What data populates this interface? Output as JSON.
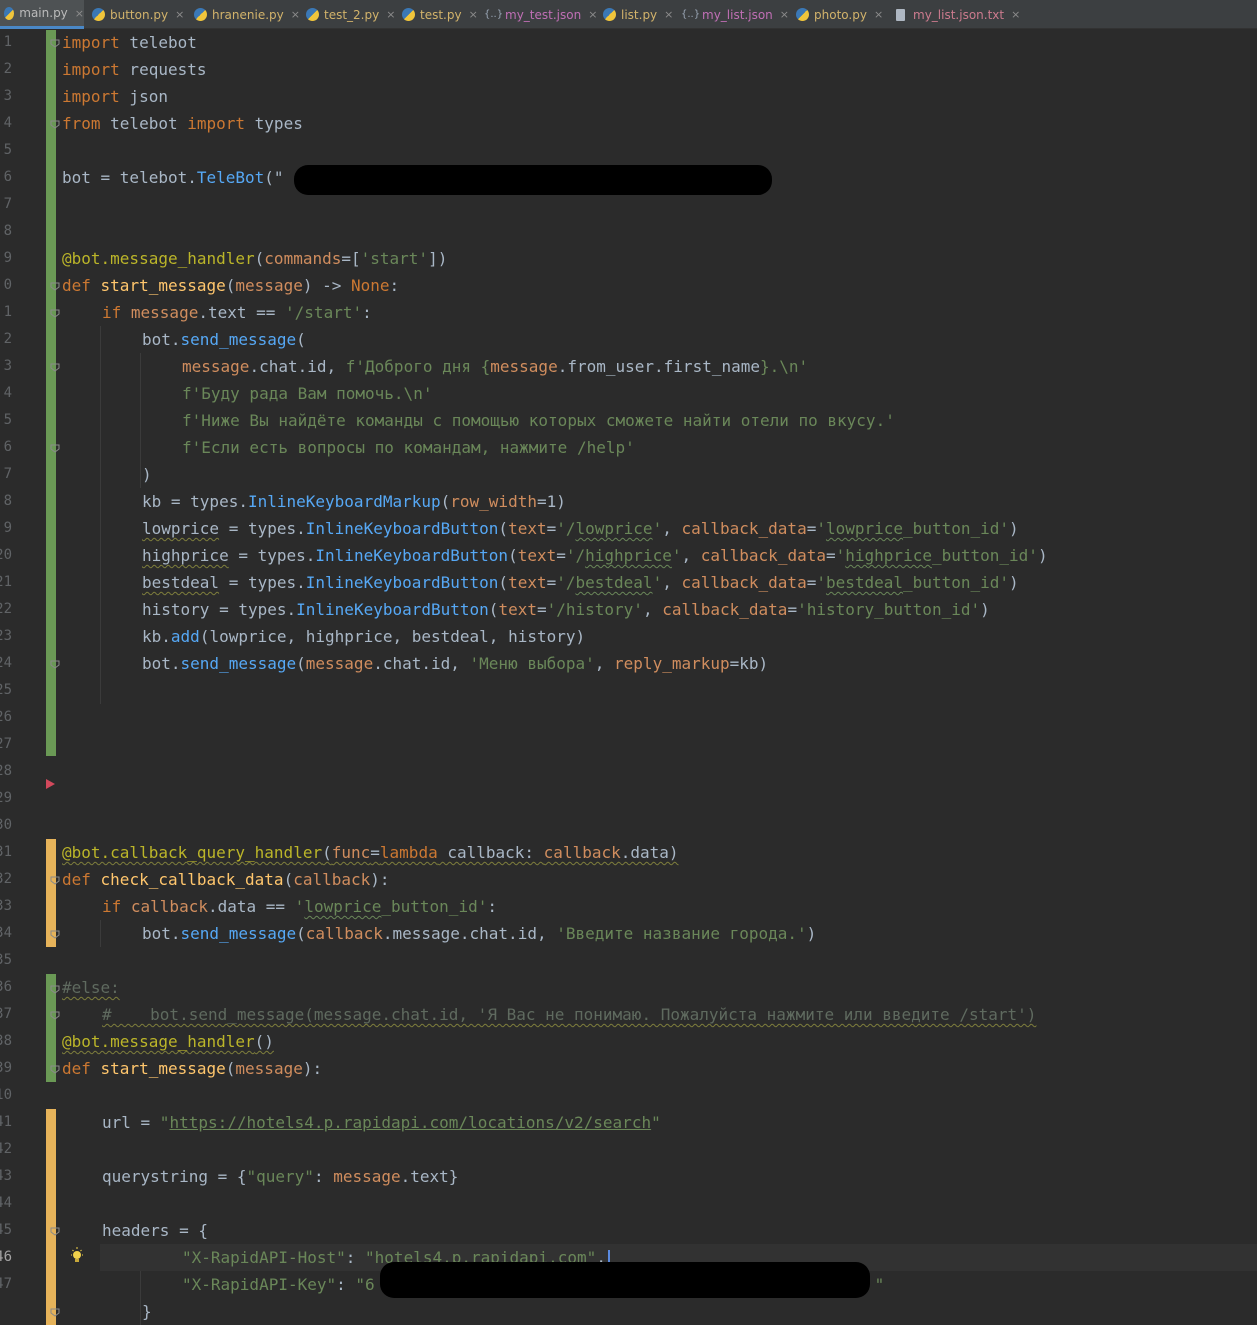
{
  "tabs": [
    {
      "label": "main.py",
      "icon": "python-file-icon",
      "active": true
    },
    {
      "label": "button.py",
      "icon": "python-file-icon"
    },
    {
      "label": "hranenie.py",
      "icon": "python-file-icon"
    },
    {
      "label": "test_2.py",
      "icon": "python-file-icon"
    },
    {
      "label": "test.py",
      "icon": "python-file-icon"
    },
    {
      "label": "my_test.json",
      "icon": "json-file-icon"
    },
    {
      "label": "list.py",
      "icon": "python-file-icon"
    },
    {
      "label": "my_list.json",
      "icon": "json-file-icon"
    },
    {
      "label": "photo.py",
      "icon": "python-file-icon"
    },
    {
      "label": "my_list.json.txt",
      "icon": "text-file-icon"
    }
  ],
  "tab_close_glyph": "×",
  "gutter_numbers": [
    "1",
    "2",
    "3",
    "4",
    "5",
    "6",
    "7",
    "8",
    "9",
    "0",
    "1",
    "2",
    "3",
    "4",
    "5",
    "6",
    "7",
    "8",
    "9",
    "20",
    "21",
    "22",
    "23",
    "24",
    "25",
    "26",
    "27",
    "28",
    "29",
    "30",
    "31",
    "32",
    "33",
    "34",
    "35",
    "36",
    "37",
    "38",
    "39",
    "10",
    "41",
    "42",
    "43",
    "44",
    "45",
    "46",
    "47"
  ],
  "code": {
    "l1_import": "import",
    "l1_mod": " telebot",
    "l2_import": "import",
    "l2_mod": " requests",
    "l3_import": "import",
    "l3_mod": " json",
    "l4_from": "from",
    "l4_mod": " telebot ",
    "l4_import": "import",
    "l4_name": " types",
    "l6_a": "bot = telebot.",
    "l6_b": "TeleBot",
    "l6_c": "(\"",
    "l9_a": "@bot.message_handler",
    "l9_b": "(",
    "l9_c": "commands",
    "l9_d": "=[",
    "l9_e": "'start'",
    "l9_f": "])",
    "l10_def": "def",
    "l10_fn": " start_message",
    "l10_b": "(",
    "l10_p": "message",
    "l10_c": ") -> ",
    "l10_none": "None",
    "l10_d": ":",
    "l11_if": "if",
    "l11_a": " message",
    "l11_b": ".text == ",
    "l11_s": "'/start'",
    "l11_c": ":",
    "l12_a": "bot.",
    "l12_m": "send_message",
    "l12_b": "(",
    "l13_p": "message",
    "l13_a": ".chat.id, ",
    "l13_s1": "f'Доброго дня {",
    "l13_p2": "message",
    "l13_a2": ".from_user.first_name",
    "l13_s2": "}.\\n'",
    "l14_s": "f'Буду рада Вам помочь.\\n'",
    "l15_s": "f'Ниже Вы найдёте команды с помощью которых сможете найти отели по вкусу.'",
    "l16_s": "f'Если есть вопросы по командам, нажмите /help'",
    "l17": ")",
    "l18_a": "kb = types.",
    "l18_c": "InlineKeyboardMarkup",
    "l18_b": "(",
    "l18_p": "row_width",
    "l18_d": "=1)",
    "l19_v": "lowprice",
    "l19_a": " = types.",
    "l19_c": "InlineKeyboardButton",
    "l19_b": "(",
    "l19_p": "text",
    "l19_e": "=",
    "l19_s1a": "'/",
    "l19_s1b": "lowprice",
    "l19_s1c": "'",
    "l19_f": ", ",
    "l19_p2": "callback_data",
    "l19_g": "=",
    "l19_s2a": "'",
    "l19_s2b": "lowprice",
    "l19_s2c": "_button_id'",
    "l19_h": ")",
    "l20_v": "highprice",
    "l20_a": " = types.",
    "l20_c": "InlineKeyboardButton",
    "l20_b": "(",
    "l20_p": "text",
    "l20_e": "=",
    "l20_s1a": "'/",
    "l20_s1b": "highprice",
    "l20_s1c": "'",
    "l20_f": ", ",
    "l20_p2": "callback_data",
    "l20_g": "=",
    "l20_s2a": "'",
    "l20_s2b": "highprice",
    "l20_s2c": "_button_id'",
    "l20_h": ")",
    "l21_v": "bestdeal",
    "l21_a": " = types.",
    "l21_c": "InlineKeyboardButton",
    "l21_b": "(",
    "l21_p": "text",
    "l21_e": "=",
    "l21_s1a": "'/",
    "l21_s1b": "bestdeal",
    "l21_s1c": "'",
    "l21_f": ", ",
    "l21_p2": "callback_data",
    "l21_g": "=",
    "l21_s2a": "'",
    "l21_s2b": "bestdeal",
    "l21_s2c": "_button_id'",
    "l21_h": ")",
    "l22_v": "history",
    "l22_a": " = types.",
    "l22_c": "InlineKeyboardButton",
    "l22_b": "(",
    "l22_p": "text",
    "l22_e": "=",
    "l22_s1": "'/history'",
    "l22_f": ", ",
    "l22_p2": "callback_data",
    "l22_g": "=",
    "l22_s2": "'history_button_id'",
    "l22_h": ")",
    "l23_a": "kb.",
    "l23_m": "add",
    "l23_b": "(lowprice, highprice, bestdeal, history)",
    "l24_a": "bot.",
    "l24_m": "send_message",
    "l24_b": "(",
    "l24_p": "message",
    "l24_c": ".chat.id, ",
    "l24_s": "'Меню выбора'",
    "l24_d": ", ",
    "l24_p2": "reply_markup",
    "l24_e": "=kb)",
    "l31_a": "@bot.callback_query_handler",
    "l31_b": "(",
    "l31_p": "func",
    "l31_c": "=",
    "l31_l": "lambda",
    "l31_d": " callback: ",
    "l31_p2": "callback",
    "l31_e": ".data)",
    "l32_def": "def",
    "l32_fn": " check_callback_data",
    "l32_b": "(",
    "l32_p": "callback",
    "l32_c": "):",
    "l33_if": "if",
    "l33_p": " callback",
    "l33_a": ".data == ",
    "l33_s1": "'",
    "l33_s2": "lowprice",
    "l33_s3": "_button_id'",
    "l33_b": ":",
    "l34_a": "bot.",
    "l34_m": "send_message",
    "l34_b": "(",
    "l34_p": "callback",
    "l34_c": ".message.chat.id, ",
    "l34_s": "'Введите название города.'",
    "l34_d": ")",
    "l36": "#else:",
    "l37": "#    bot.send_message(message.chat.id, 'Я Вас не понимаю. Пожалуйста нажмите или введите /start')",
    "l38_a": "@bot.message_handler",
    "l38_b": "()",
    "l39_def": "def",
    "l39_fn": " start_message",
    "l39_b": "(",
    "l39_p": "message",
    "l39_c": "):",
    "l41_a": "url = ",
    "l41_q1": "\"",
    "l41_u": "https://hotels4.p.rapidapi.com/locations/v2/search",
    "l41_q2": "\"",
    "l43_a": "querystring = {",
    "l43_s": "\"query\"",
    "l43_b": ": ",
    "l43_p": "message",
    "l43_c": ".text}",
    "l45": "headers = {",
    "l46_s1": "\"X-RapidAPI-Host\"",
    "l46_a": ": ",
    "l46_s2a": "\"hotels4.p.",
    "l46_s2b": "rapidapi",
    "l46_s2c": ".com\"",
    "l46_b": ",",
    "l47_s1": "\"X-RapidAPI-Key\"",
    "l47_a": ": ",
    "l47_s2": "\"6",
    "l47_s3": "\"",
    "l48": "}"
  },
  "colors": {
    "bg": "#2b2b2b",
    "keyword": "#cc7832",
    "string": "#6a8759",
    "decorator": "#bbb529",
    "function": "#ffc66d",
    "change_green": "#6a9955",
    "change_yellow": "#e6b35a"
  }
}
